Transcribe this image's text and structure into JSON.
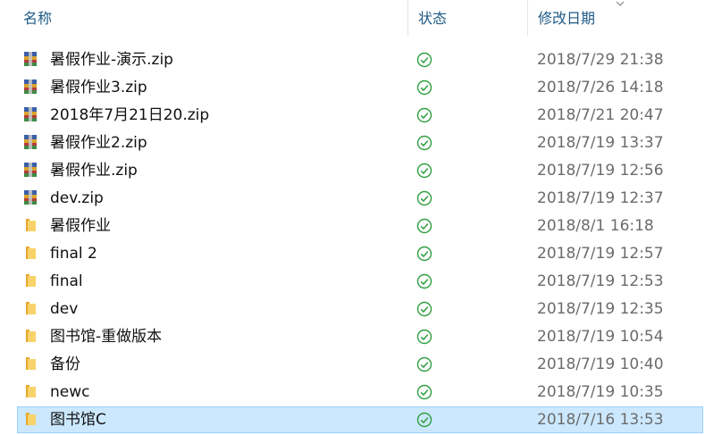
{
  "columns": {
    "name": "名称",
    "status": "状态",
    "modified": "修改日期"
  },
  "colors": {
    "header_text": "#1f5a86",
    "selected_bg": "#cce8ff",
    "status_ok": "#2e9e3e",
    "folder": "#f5c342"
  },
  "files": [
    {
      "name": "暑假作业-演示.zip",
      "type": "zip-archive-icon",
      "status": "synced-check-icon",
      "date": "2018/7/29 21:38"
    },
    {
      "name": "暑假作业3.zip",
      "type": "zip-archive-icon",
      "status": "synced-check-icon",
      "date": "2018/7/26 14:18"
    },
    {
      "name": "2018年7月21日20.zip",
      "type": "zip-archive-icon",
      "status": "synced-check-icon",
      "date": "2018/7/21 20:47"
    },
    {
      "name": "暑假作业2.zip",
      "type": "zip-archive-icon",
      "status": "synced-check-icon",
      "date": "2018/7/19 13:37"
    },
    {
      "name": "暑假作业.zip",
      "type": "zip-archive-icon",
      "status": "synced-check-icon",
      "date": "2018/7/19 12:56"
    },
    {
      "name": "dev.zip",
      "type": "zip-archive-icon",
      "status": "synced-check-icon",
      "date": "2018/7/19 12:37"
    },
    {
      "name": "暑假作业",
      "type": "folder-icon",
      "status": "synced-check-icon",
      "date": "2018/8/1 16:18"
    },
    {
      "name": "final 2",
      "type": "folder-icon",
      "status": "synced-check-icon",
      "date": "2018/7/19 12:57"
    },
    {
      "name": "final",
      "type": "folder-icon",
      "status": "synced-check-icon",
      "date": "2018/7/19 12:53"
    },
    {
      "name": "dev",
      "type": "folder-icon",
      "status": "synced-check-icon",
      "date": "2018/7/19 12:35"
    },
    {
      "name": "图书馆-重做版本",
      "type": "folder-icon",
      "status": "synced-check-icon",
      "date": "2018/7/19 10:54"
    },
    {
      "name": "备份",
      "type": "folder-icon",
      "status": "synced-check-icon",
      "date": "2018/7/19 10:40"
    },
    {
      "name": "newc",
      "type": "folder-icon",
      "status": "synced-check-icon",
      "date": "2018/7/19 10:35"
    },
    {
      "name": "图书馆C",
      "type": "folder-icon",
      "status": "synced-check-icon",
      "date": "2018/7/16 13:53",
      "selected": true
    }
  ]
}
